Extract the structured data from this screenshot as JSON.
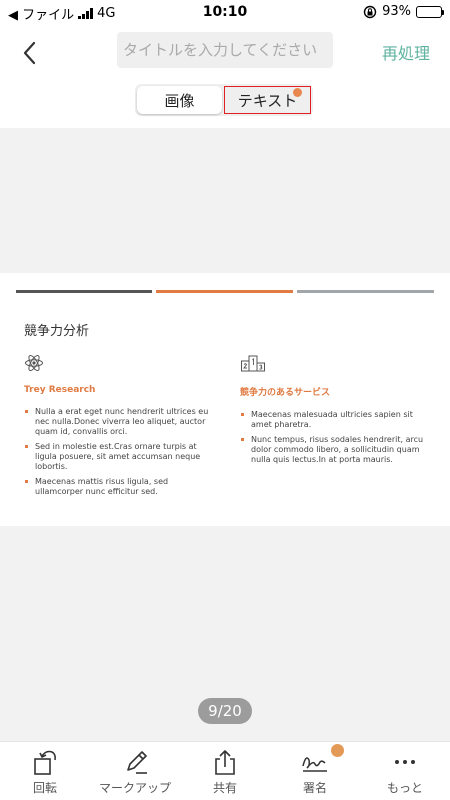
{
  "status_bar": {
    "carrier_back": "◀ ファイル",
    "network": "4G",
    "time": "10:10",
    "battery": "93%"
  },
  "nav": {
    "title_placeholder": "タイトルを入力してください",
    "reprocess_label": "再処理",
    "tabs": [
      {
        "label": "画像"
      },
      {
        "label": "テキスト"
      }
    ]
  },
  "document": {
    "title": "競争力分析",
    "accent_colors": [
      "#555555",
      "#e07b43",
      "#a0a6aa"
    ],
    "columns": [
      {
        "heading": "Trey Research",
        "icon": "atom-icon",
        "bullets": [
          "Nulla a erat eget nunc hendrerit ultrices eu nec nulla.Donec viverra leo aliquet, auctor quam id, convallis orci.",
          "Sed in molestie est.Cras ornare turpis at ligula posuere, sit amet accumsan neque lobortis.",
          "Maecenas mattis risus ligula, sed ullamcorper nunc efficitur sed."
        ]
      },
      {
        "heading": "競争力のあるサービス",
        "icon": "podium-icon",
        "bullets": [
          "Maecenas malesuada ultricies sapien sit amet pharetra.",
          "Nunc tempus, risus sodales hendrerit, arcu dolor commodo libero, a sollicitudin quam nulla quis lectus.In at porta mauris."
        ]
      }
    ]
  },
  "page_indicator": "9/20",
  "toolbar": [
    {
      "label": "回転",
      "icon": "rotate-icon"
    },
    {
      "label": "マークアップ",
      "icon": "pen-icon"
    },
    {
      "label": "共有",
      "icon": "share-icon"
    },
    {
      "label": "署名",
      "icon": "signature-icon"
    },
    {
      "label": "もっと",
      "icon": "more-icon"
    }
  ]
}
